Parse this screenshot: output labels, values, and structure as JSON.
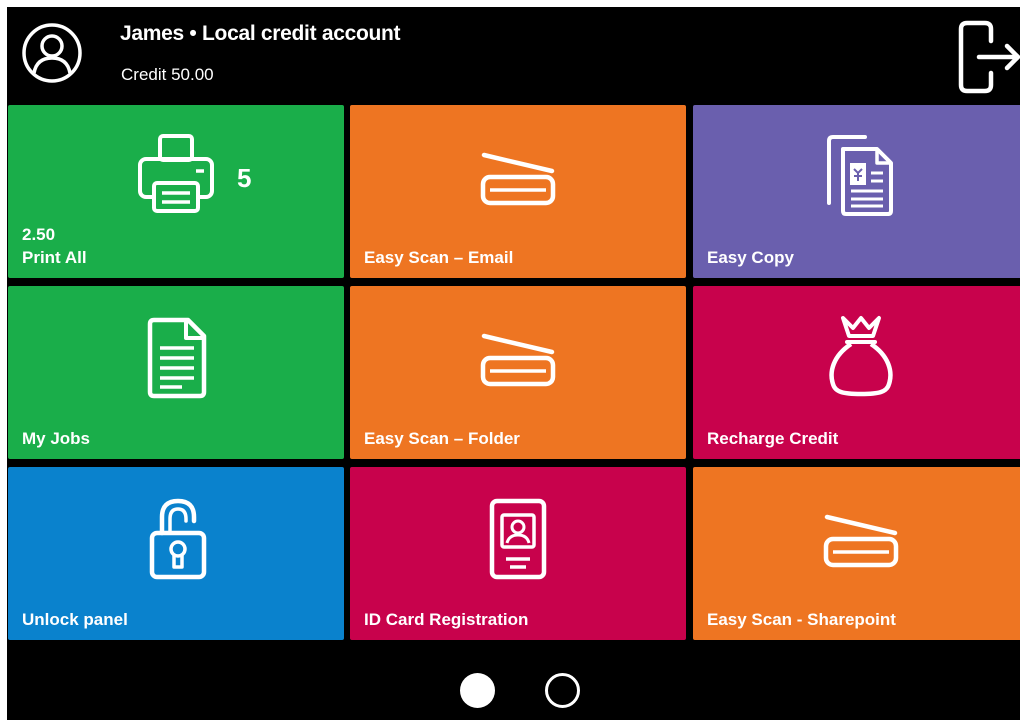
{
  "header": {
    "user_title": "James • Local credit account",
    "credit": "Credit 50.00"
  },
  "tiles": [
    {
      "label": "Print All",
      "value": "2.50",
      "count": "5",
      "color": "#1aae4a",
      "icon": "printer-icon"
    },
    {
      "label": "Easy Scan – Email",
      "color": "#ee7522",
      "icon": "scanner-icon"
    },
    {
      "label": "Easy Copy",
      "color": "#6a5fae",
      "icon": "copy-documents-icon"
    },
    {
      "label": "My Jobs",
      "color": "#1aae4a",
      "icon": "document-icon"
    },
    {
      "label": "Easy Scan – Folder",
      "color": "#ee7522",
      "icon": "scanner-icon"
    },
    {
      "label": "Recharge Credit",
      "color": "#c8024c",
      "icon": "money-bag-icon"
    },
    {
      "label": "Unlock panel",
      "color": "#0a82cd",
      "icon": "unlocked-padlock-icon"
    },
    {
      "label": "ID Card Registration",
      "color": "#c8024c",
      "icon": "id-card-icon"
    },
    {
      "label": "Easy Scan - Sharepoint",
      "color": "#ee7522",
      "icon": "scanner-icon"
    }
  ],
  "pager": {
    "pages": 2,
    "current_page": 1
  }
}
